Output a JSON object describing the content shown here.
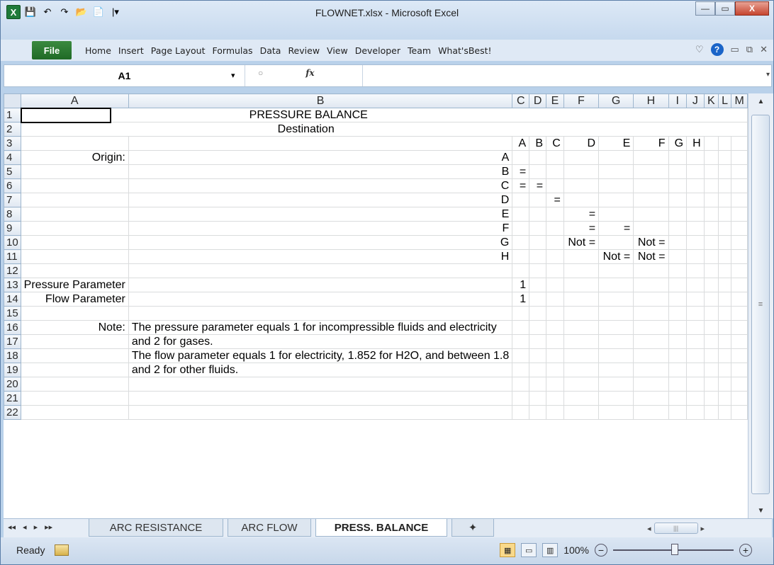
{
  "window": {
    "title": "FLOWNET.xlsx - Microsoft Excel",
    "minimize": "—",
    "maximize": "▭",
    "close": "X"
  },
  "qat": {
    "logo": "X",
    "save_icon": "💾",
    "undo_icon": "↶",
    "redo_icon": "↷",
    "open_icon": "📂",
    "new_icon": "📄",
    "more_icon": "|▾"
  },
  "menu": {
    "file": "File",
    "items": [
      "Home",
      "Insert",
      "Page Layout",
      "Formulas",
      "Data",
      "Review",
      "View",
      "Developer",
      "Team",
      "What'sBest!"
    ],
    "help": "?",
    "right_icons": {
      "heart": "♡",
      "min": "▭",
      "restore": "⧉",
      "close": "✕"
    }
  },
  "formula_bar": {
    "name_box": "A1",
    "dropdown": "▾",
    "cancel_icon": "○",
    "fx": "fx",
    "formula": "",
    "expand": "▾"
  },
  "columns": [
    "A",
    "B",
    "C",
    "D",
    "E",
    "F",
    "G",
    "H",
    "I",
    "J",
    "K",
    "L",
    "M"
  ],
  "rows": [
    {
      "n": "1",
      "cells": {
        "center_title": "PRESSURE BALANCE"
      }
    },
    {
      "n": "2",
      "cells": {
        "center_title": "Destination"
      }
    },
    {
      "n": "3",
      "cells": {
        "C": "A",
        "D": "B",
        "E": "C",
        "F": "D",
        "G": "E",
        "H": "F",
        "I": "G",
        "J": "H"
      }
    },
    {
      "n": "4",
      "cells": {
        "A": "Origin:",
        "B": "A"
      }
    },
    {
      "n": "5",
      "cells": {
        "B": "B",
        "C": "="
      }
    },
    {
      "n": "6",
      "cells": {
        "B": "C",
        "C": "=",
        "D": "="
      }
    },
    {
      "n": "7",
      "cells": {
        "B": "D",
        "E": "="
      }
    },
    {
      "n": "8",
      "cells": {
        "B": "E",
        "F": "="
      }
    },
    {
      "n": "9",
      "cells": {
        "B": "F",
        "F": "=",
        "G": "="
      }
    },
    {
      "n": "10",
      "cells": {
        "B": "G",
        "F": "Not =",
        "H": "Not ="
      }
    },
    {
      "n": "11",
      "cells": {
        "B": "H",
        "G": "Not =",
        "H": "Not ="
      }
    },
    {
      "n": "12",
      "cells": {}
    },
    {
      "n": "13",
      "cells": {
        "A": "Pressure Parameter",
        "C": "1"
      }
    },
    {
      "n": "14",
      "cells": {
        "A": "Flow Parameter",
        "C": "1"
      }
    },
    {
      "n": "15",
      "cells": {}
    },
    {
      "n": "16",
      "cells": {
        "A": "Note:",
        "B": "The pressure parameter equals 1 for incompressible fluids and electricity"
      }
    },
    {
      "n": "17",
      "cells": {
        "B": "and 2 for gases."
      }
    },
    {
      "n": "18",
      "cells": {
        "B": "The flow parameter equals 1 for electricity, 1.852 for H2O, and between 1.8"
      }
    },
    {
      "n": "19",
      "cells": {
        "B": "and 2 for other fluids."
      }
    },
    {
      "n": "20",
      "cells": {}
    },
    {
      "n": "21",
      "cells": {}
    },
    {
      "n": "22",
      "cells": {}
    }
  ],
  "sheet_tabs": {
    "nav": [
      "◂◂",
      "◂",
      "▸",
      "▸▸"
    ],
    "tabs": [
      "ARC RESISTANCE",
      "ARC FLOW",
      "PRESS. BALANCE"
    ],
    "active": "PRESS. BALANCE",
    "new_sheet_icon": "✦"
  },
  "status": {
    "ready": "Ready",
    "zoom": "100%",
    "zoom_out": "−",
    "zoom_in": "+"
  }
}
